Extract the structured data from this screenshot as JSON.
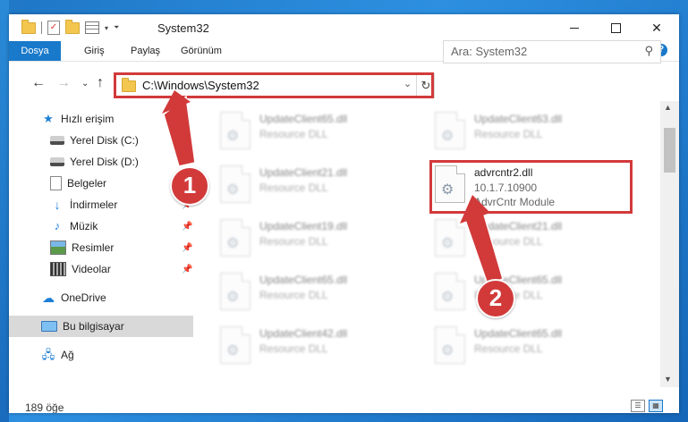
{
  "window": {
    "title": "System32",
    "min_icon": "minimize-icon",
    "max_icon": "maximize-icon",
    "close_icon": "close-icon"
  },
  "ribbon": {
    "tabs": [
      "Dosya",
      "Giriş",
      "Paylaş",
      "Görünüm"
    ],
    "help": "?"
  },
  "navigation": {
    "back_icon": "back-arrow-icon",
    "forward_icon": "forward-arrow-icon",
    "recent_icon": "chevron-down-icon",
    "up_icon": "up-arrow-icon",
    "address": "C:\\Windows\\System32",
    "search_placeholder": "Ara: System32"
  },
  "sidebar": {
    "items": [
      {
        "label": "Hızlı erişim",
        "icon": "star-icon"
      },
      {
        "label": "Yerel Disk (C:)",
        "icon": "drive-icon",
        "pinned": true
      },
      {
        "label": "Yerel Disk (D:)",
        "icon": "drive-icon",
        "pinned": true
      },
      {
        "label": "Belgeler",
        "icon": "documents-icon",
        "pinned": true
      },
      {
        "label": "İndirmeler",
        "icon": "downloads-icon",
        "pinned": true
      },
      {
        "label": "Müzik",
        "icon": "music-icon",
        "pinned": true
      },
      {
        "label": "Resimler",
        "icon": "pictures-icon",
        "pinned": true
      },
      {
        "label": "Videolar",
        "icon": "videos-icon",
        "pinned": true
      },
      {
        "label": "OneDrive",
        "icon": "onedrive-icon"
      },
      {
        "label": "Bu bilgisayar",
        "icon": "this-pc-icon",
        "selected": true
      },
      {
        "label": "Ağ",
        "icon": "network-icon"
      }
    ]
  },
  "files": {
    "col1": [
      {
        "name": "UpdateClient65.dll",
        "desc": "Resource DLL"
      },
      {
        "name": "UpdateClient21.dll",
        "desc": "Resource DLL"
      },
      {
        "name": "UpdateClient19.dll",
        "desc": "Resource DLL"
      },
      {
        "name": "UpdateClient65.dll",
        "desc": "Resource DLL"
      },
      {
        "name": "UpdateClient42.dll",
        "desc": "Resource DLL"
      }
    ],
    "col2": [
      {
        "name": "UpdateClient63.dll",
        "desc": "Resource DLL"
      },
      {
        "name": "UpdateClient21.dll",
        "desc": "Resource DLL"
      },
      {
        "name": "UpdateClient65.dll",
        "desc": "Resource DLL"
      },
      {
        "name": "UpdateClient65.dll",
        "desc": "Resource DLL"
      }
    ],
    "highlighted": {
      "name": "advrcntr2.dll",
      "version": "10.1.7.10900",
      "desc": "AdvrCntr Module"
    }
  },
  "status": {
    "item_count": "189 öğe"
  },
  "annotations": {
    "badge1": "1",
    "badge2": "2",
    "color": "#d23a3a"
  }
}
